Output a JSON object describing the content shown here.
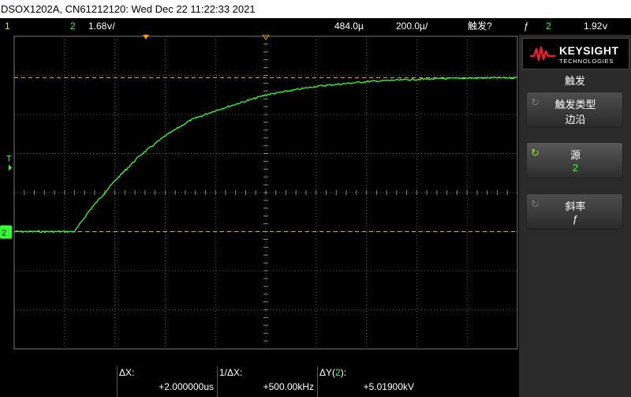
{
  "title": "DSOX1202A, CN61212120: Wed Dec 22 11:22:33 2021",
  "status": {
    "ch1_num": "1",
    "ch2_num": "2",
    "ch2_scale": "1.68ⅴ/",
    "time_delay": "484.0µ",
    "time_scale": "200.0µ/",
    "trig_state": "触发?",
    "trig_slope_icon": "ƒ",
    "trig_source": "2",
    "trig_level": "1.92ⅴ"
  },
  "sidebar": {
    "brand": "KEYSIGHT",
    "brand_sub": "TECHNOLOGIES",
    "menu_title": "触发",
    "softkeys": [
      {
        "label": "触发类型",
        "value": "边沿"
      },
      {
        "label": "源",
        "value": "2"
      },
      {
        "label": "斜率",
        "value": "ƒ"
      }
    ]
  },
  "markers": {
    "trigger_T": "T",
    "ch2_marker": "2"
  },
  "measurements": {
    "dx_label": "ΔX:",
    "dx_value": "+2.000000us",
    "inv_dx_label": "1/ΔX:",
    "inv_dx_value": "+500.00kHz",
    "dy_label_prefix": "ΔY(",
    "dy_label_ch": "2",
    "dy_label_suffix": "):",
    "dy_value": "+5.01900kV"
  },
  "colors": {
    "ch1": "#f3e600",
    "ch2": "#33ff33",
    "cursor": "#e8a040",
    "grid": "#5a5a5a",
    "trigger_marker": "#ff9900"
  },
  "chart_data": {
    "type": "line",
    "series": [
      {
        "values_description": "",
        "x_div": [
          0,
          0.55,
          1,
          1.2,
          1.5,
          2,
          2.5,
          3,
          3.5,
          4,
          5,
          6,
          7,
          8,
          9,
          10
        ],
        "y_div": [
          3.0,
          3.0,
          3.0,
          3.0,
          3.55,
          4.3,
          4.95,
          5.45,
          5.85,
          6.1,
          6.5,
          6.72,
          6.84,
          6.9,
          6.93,
          6.94
        ]
      }
    ],
    "grid_divisions_x": 10,
    "grid_divisions_y": 8,
    "grid": true
  }
}
